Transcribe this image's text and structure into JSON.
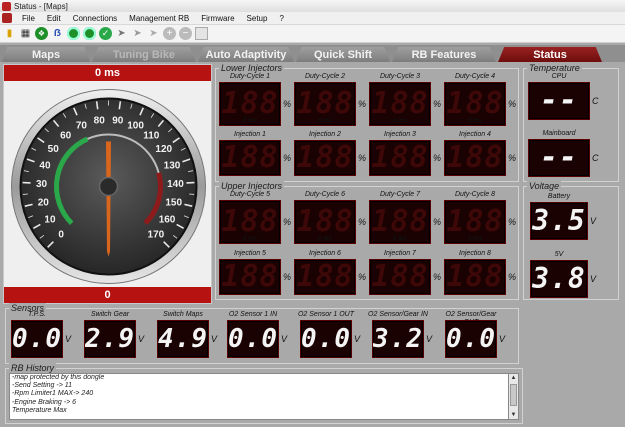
{
  "window": {
    "title": "Status - [Maps]"
  },
  "menu": [
    "File",
    "Edit",
    "Connections",
    "Management RB",
    "Firmware",
    "Setup",
    "?"
  ],
  "toolbar": {
    "icons": [
      "folder-icon",
      "save-icon",
      "usb-icon",
      "bluetooth-icon",
      "usb-connect-icon",
      "bluetooth-connect-icon",
      "check-icon",
      "pin-icon",
      "pin-disabled-icon",
      "pin-gray-icon",
      "plus-icon",
      "minus-icon",
      "resize-icon"
    ]
  },
  "tabs": [
    {
      "label": "Maps",
      "state": "normal"
    },
    {
      "label": "Tuning Bike",
      "state": "disabled"
    },
    {
      "label": "Auto Adaptivity",
      "state": "normal"
    },
    {
      "label": "Quick Shift",
      "state": "normal"
    },
    {
      "label": "RB Features",
      "state": "normal"
    },
    {
      "label": "Status",
      "state": "active"
    }
  ],
  "gauge": {
    "top_value": "0 ms",
    "bottom_value": "0",
    "ticks": [
      "0",
      "10",
      "20",
      "30",
      "40",
      "50",
      "60",
      "70",
      "80",
      "90",
      "100",
      "110",
      "120",
      "130",
      "140",
      "150",
      "160",
      "170"
    ],
    "needle_value": 0
  },
  "lower_injectors": {
    "title": "Lower Injectors",
    "duty": [
      {
        "label": "Duty-Cycle 1",
        "value": "188",
        "unit": "%",
        "ms": "0 ms"
      },
      {
        "label": "Duty-Cycle 2",
        "value": "188",
        "unit": "%",
        "ms": "0 ms"
      },
      {
        "label": "Duty-Cycle 3",
        "value": "188",
        "unit": "%",
        "ms": "0 ms"
      },
      {
        "label": "Duty-Cycle 4",
        "value": "188",
        "unit": "%",
        "ms": "0 ms"
      }
    ],
    "injection": [
      {
        "label": "Injection 1",
        "value": "188",
        "unit": "%"
      },
      {
        "label": "Injection 2",
        "value": "188",
        "unit": "%"
      },
      {
        "label": "Injection 3",
        "value": "188",
        "unit": "%"
      },
      {
        "label": "Injection 4",
        "value": "188",
        "unit": "%"
      }
    ]
  },
  "upper_injectors": {
    "title": "Upper Injectors",
    "duty": [
      {
        "label": "Duty-Cycle 5",
        "value": "188",
        "unit": "%",
        "ms": "0 ms"
      },
      {
        "label": "Duty-Cycle 6",
        "value": "188",
        "unit": "%",
        "ms": "0 ms"
      },
      {
        "label": "Duty-Cycle 7",
        "value": "188",
        "unit": "%",
        "ms": "0 ms"
      },
      {
        "label": "Duty-Cycle 8",
        "value": "188",
        "unit": "%",
        "ms": "0 ms"
      }
    ],
    "injection": [
      {
        "label": "Injection 5",
        "value": "188",
        "unit": "%"
      },
      {
        "label": "Injection 6",
        "value": "188",
        "unit": "%"
      },
      {
        "label": "Injection 7",
        "value": "188",
        "unit": "%"
      },
      {
        "label": "Injection 8",
        "value": "188",
        "unit": "%"
      }
    ]
  },
  "temperature": {
    "title": "Temperature",
    "items": [
      {
        "label": "CPU",
        "value": "--",
        "unit": "C"
      },
      {
        "label": "Mainboard",
        "value": "--",
        "unit": "C"
      }
    ]
  },
  "voltage": {
    "title": "Voltage",
    "items": [
      {
        "label": "Battery",
        "value": "3.5",
        "unit": "V"
      },
      {
        "label": "5V",
        "value": "3.8",
        "unit": "V"
      }
    ]
  },
  "sensors": {
    "title": "Sensors",
    "items": [
      {
        "label": "T.P.S.",
        "value": "0.0",
        "unit": "V"
      },
      {
        "label": "Switch Gear",
        "value": "2.9",
        "unit": "V"
      },
      {
        "label": "Switch Maps",
        "value": "4.9",
        "unit": "V"
      },
      {
        "label": "O2 Sensor 1 IN",
        "value": "0.0",
        "unit": "V"
      },
      {
        "label": "O2 Sensor 1 OUT",
        "value": "0.0",
        "unit": "V"
      },
      {
        "label": "O2 Sensor/Gear IN",
        "value": "3.2",
        "unit": "V"
      },
      {
        "label": "O2 Sensor/Gear OUT",
        "value": "0.0",
        "unit": "V"
      }
    ]
  },
  "history": {
    "title": "RB History",
    "lines": [
      "-map protected by this dongle",
      "-Send Setting -> 11",
      "-Rpm Limiter1 MAX-> 240",
      "-Engine Braking -> 6",
      "Temperature Max"
    ]
  },
  "colors": {
    "accent_red": "#b61212",
    "display_bg": "#1a0202",
    "segment_off": "#3e0808",
    "segment_on": "#f4f4f4"
  }
}
